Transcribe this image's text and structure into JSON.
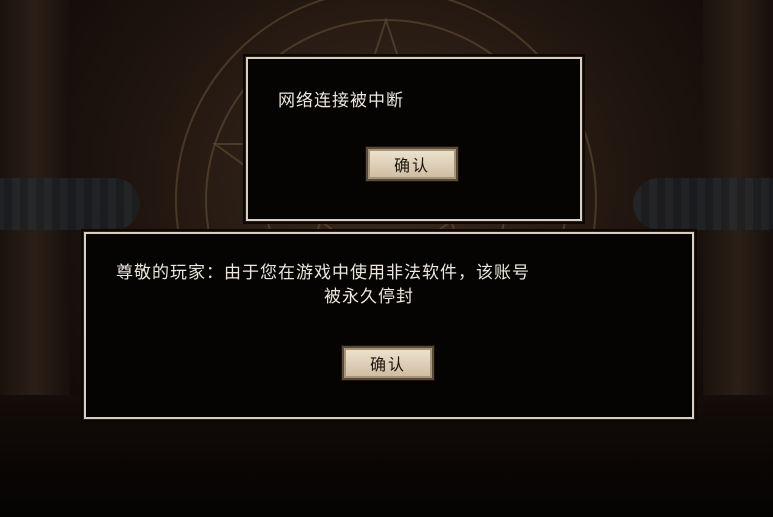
{
  "dialog_network": {
    "message": "网络连接被中断",
    "confirm_label": "确认"
  },
  "dialog_ban": {
    "message_line1": "尊敬的玩家：由于您在游戏中使用非法软件，该账号",
    "message_line2": "被永久停封",
    "confirm_label": "确认"
  },
  "colors": {
    "dialog_bg": "#050403",
    "dialog_border": "#d9cfc0",
    "button_bg": "#e2d4bc",
    "text": "#ece6dc"
  }
}
